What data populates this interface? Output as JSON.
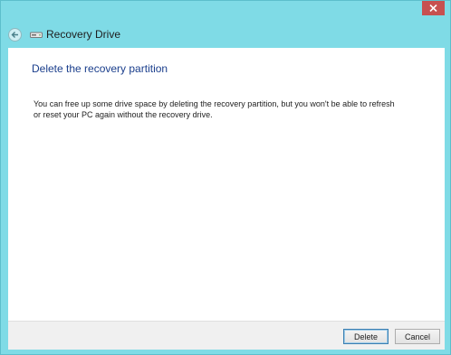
{
  "window": {
    "title": "Recovery Drive",
    "close_icon": "close-icon",
    "back_icon": "back-arrow-icon",
    "drive_icon": "drive-icon"
  },
  "main": {
    "heading": "Delete the recovery partition",
    "description": "You can free up some drive space by deleting the recovery partition, but you won't be able to refresh or reset your PC again without the recovery drive."
  },
  "footer": {
    "delete_label": "Delete",
    "cancel_label": "Cancel"
  },
  "colors": {
    "frame": "#7fdbe6",
    "close_button": "#c75050",
    "heading": "#1a3e8c"
  }
}
